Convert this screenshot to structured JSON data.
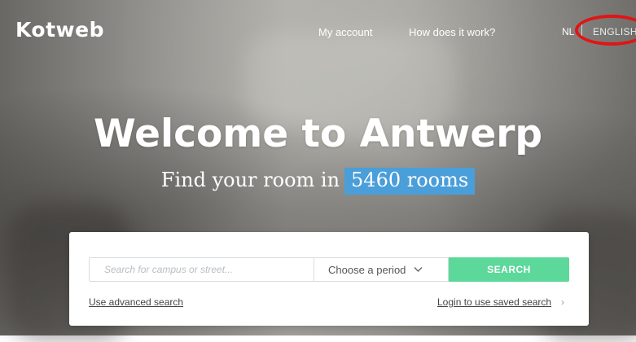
{
  "header": {
    "logo": "Kotweb",
    "nav": {
      "my_account": "My account",
      "how_it_works": "How does it work?",
      "lang_nl": "NL",
      "lang_en": "ENGLISH"
    }
  },
  "hero": {
    "title": "Welcome to Antwerp",
    "subtitle_prefix": "Find your room in",
    "room_count": "5460 rooms"
  },
  "search": {
    "placeholder": "Search for campus or street...",
    "period_label": "Choose a period",
    "button_label": "SEARCH",
    "advanced_link": "Use advanced search",
    "saved_link": "Login to use saved search"
  },
  "colors": {
    "accent_green": "#5cd89a",
    "highlight_blue": "#4a9ed9",
    "annotation_red": "#e01515"
  },
  "icons": {
    "chevron": "chevron-down-icon",
    "arrow": "chevron-right-icon"
  }
}
